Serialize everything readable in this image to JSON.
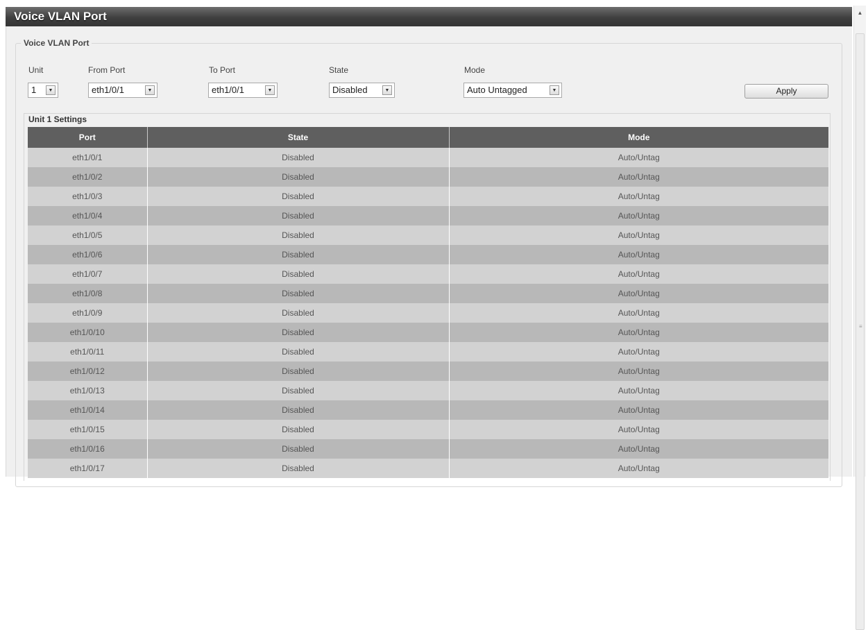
{
  "window": {
    "title": "Voice VLAN Port"
  },
  "form": {
    "legend": "Voice VLAN Port",
    "unit": {
      "label": "Unit",
      "value": "1"
    },
    "from_port": {
      "label": "From Port",
      "value": "eth1/0/1"
    },
    "to_port": {
      "label": "To Port",
      "value": "eth1/0/1"
    },
    "state": {
      "label": "State",
      "value": "Disabled"
    },
    "mode": {
      "label": "Mode",
      "value": "Auto Untagged"
    },
    "apply_label": "Apply"
  },
  "settings": {
    "title": "Unit 1 Settings",
    "columns": [
      "Port",
      "State",
      "Mode"
    ],
    "rows": [
      [
        "eth1/0/1",
        "Disabled",
        "Auto/Untag"
      ],
      [
        "eth1/0/2",
        "Disabled",
        "Auto/Untag"
      ],
      [
        "eth1/0/3",
        "Disabled",
        "Auto/Untag"
      ],
      [
        "eth1/0/4",
        "Disabled",
        "Auto/Untag"
      ],
      [
        "eth1/0/5",
        "Disabled",
        "Auto/Untag"
      ],
      [
        "eth1/0/6",
        "Disabled",
        "Auto/Untag"
      ],
      [
        "eth1/0/7",
        "Disabled",
        "Auto/Untag"
      ],
      [
        "eth1/0/8",
        "Disabled",
        "Auto/Untag"
      ],
      [
        "eth1/0/9",
        "Disabled",
        "Auto/Untag"
      ],
      [
        "eth1/0/10",
        "Disabled",
        "Auto/Untag"
      ],
      [
        "eth1/0/11",
        "Disabled",
        "Auto/Untag"
      ],
      [
        "eth1/0/12",
        "Disabled",
        "Auto/Untag"
      ],
      [
        "eth1/0/13",
        "Disabled",
        "Auto/Untag"
      ],
      [
        "eth1/0/14",
        "Disabled",
        "Auto/Untag"
      ],
      [
        "eth1/0/15",
        "Disabled",
        "Auto/Untag"
      ],
      [
        "eth1/0/16",
        "Disabled",
        "Auto/Untag"
      ],
      [
        "eth1/0/17",
        "Disabled",
        "Auto/Untag"
      ]
    ]
  },
  "icons": {
    "dropdown": "chevron-down-icon",
    "scroll_up": "chevron-up-icon",
    "scroll_grip": "grip-icon"
  },
  "colors": {
    "title_bar": "#3f3f3f",
    "table_header": "#5f5f5f",
    "row_light": "#d2d2d2",
    "row_dark": "#b8b8b8"
  }
}
